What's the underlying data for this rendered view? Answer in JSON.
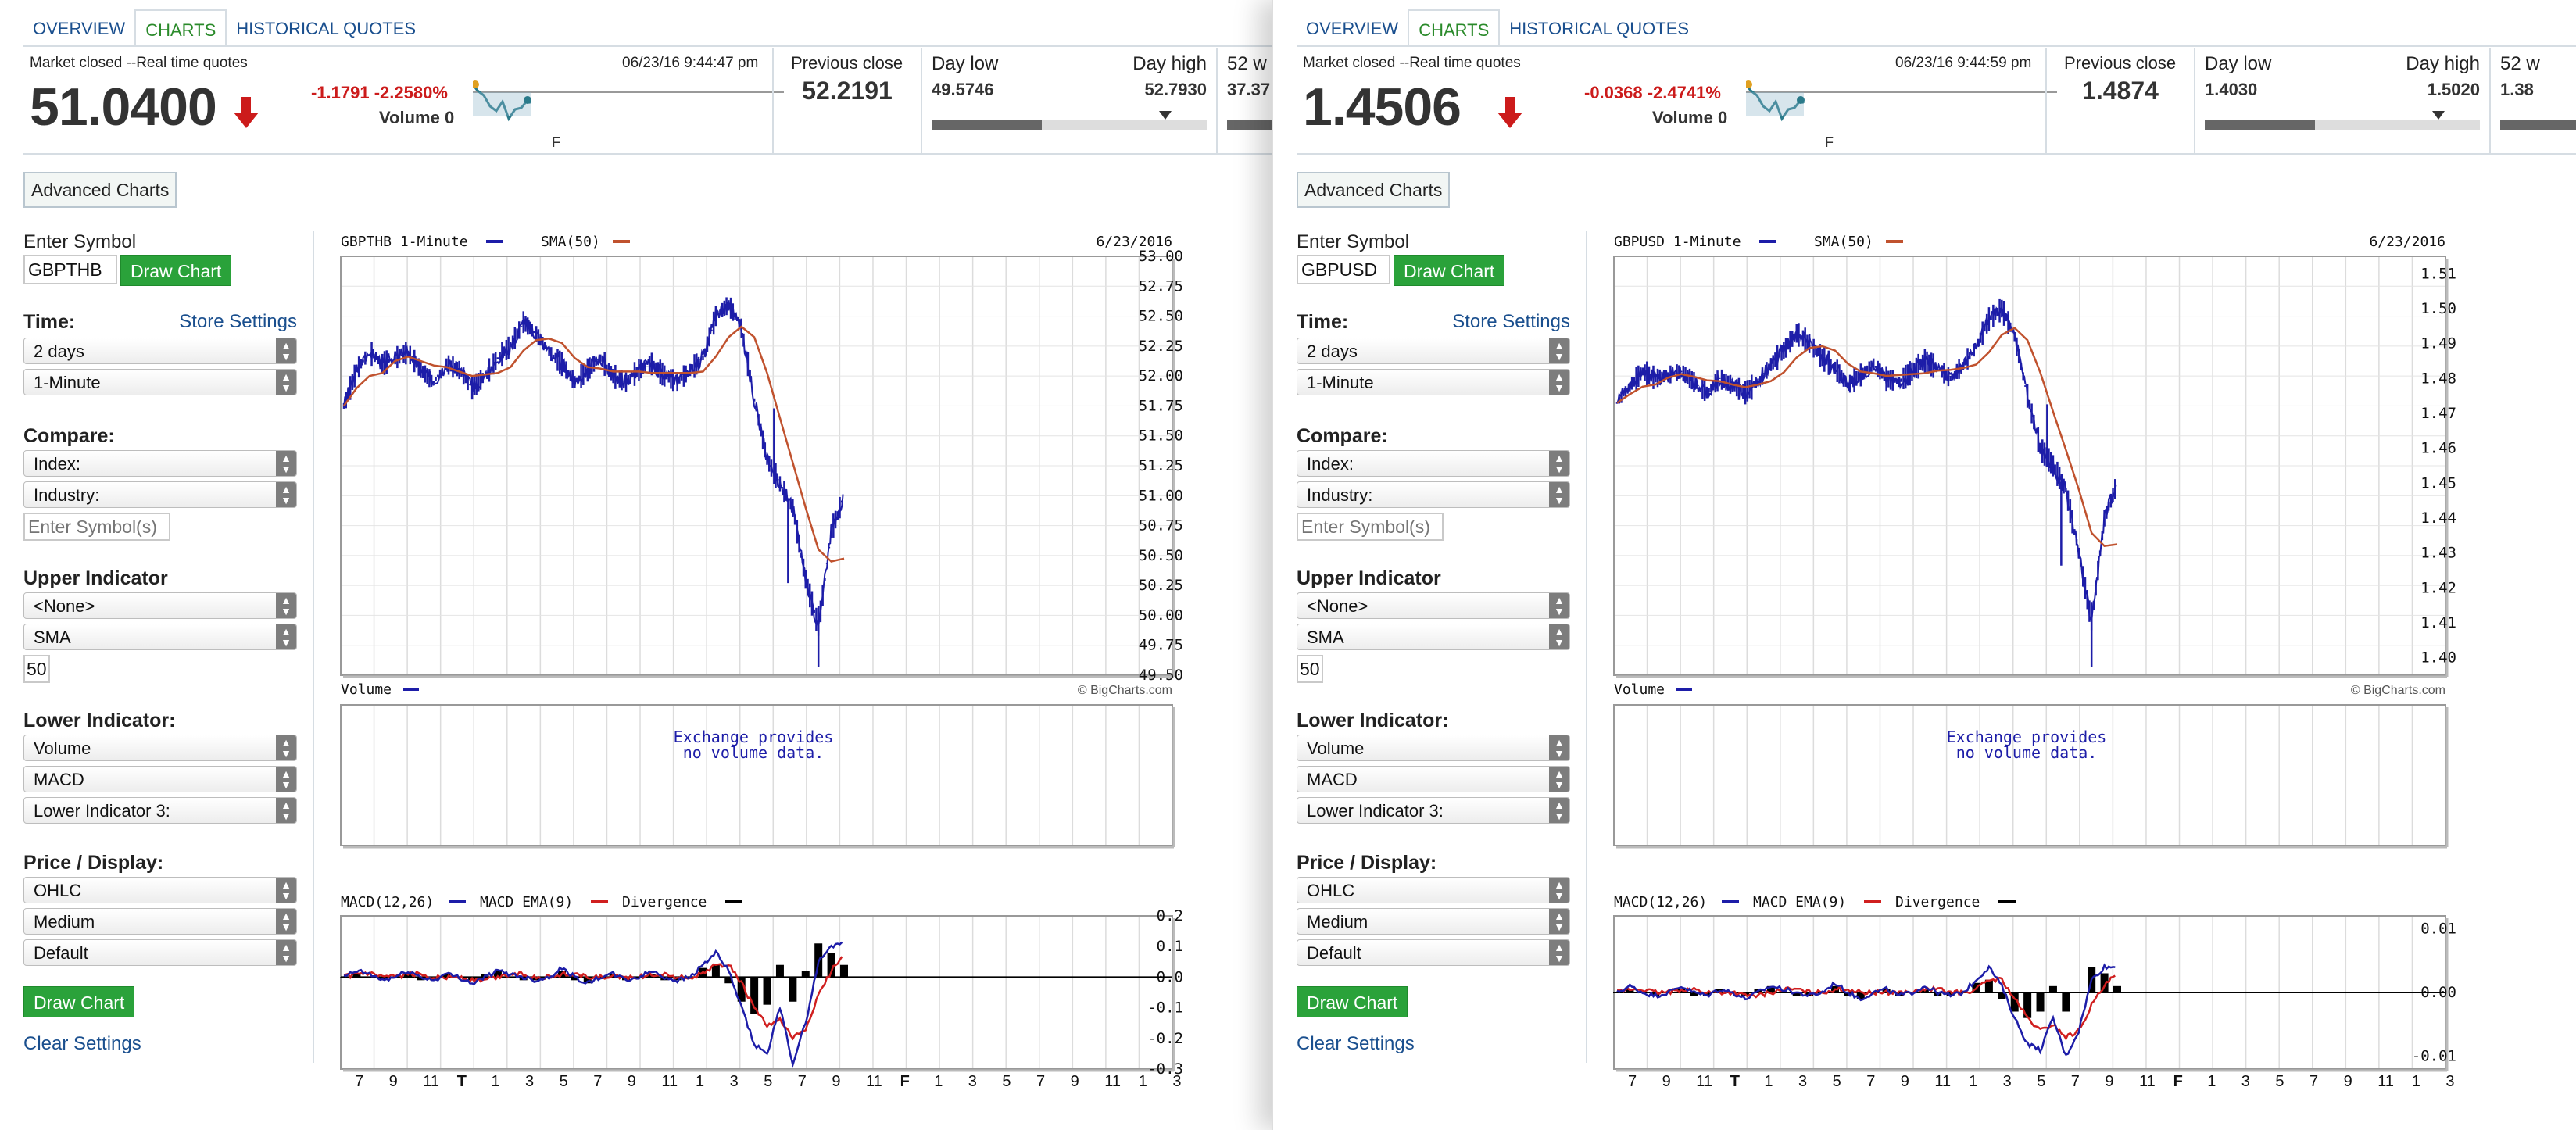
{
  "panes": [
    {
      "tabs": [
        "OVERVIEW",
        "CHARTS",
        "HISTORICAL QUOTES"
      ],
      "active_tab": 1,
      "quote": {
        "status": "Market closed --Real time quotes",
        "timestamp": "06/23/16 9:44:47 pm",
        "price": "51.0400",
        "change": "-1.1791 -2.2580%",
        "volume": "Volume 0",
        "sparkline_label": "F",
        "previous_close_label": "Previous close",
        "previous_close": "52.2191",
        "day_low_label": "Day low",
        "day_low": "49.5746",
        "day_high_label": "Day high",
        "day_high": "52.7930",
        "range_position": 0.4,
        "wk52_label": "52 w",
        "wk52_value": "37.37"
      },
      "sidebar": {
        "advanced_charts": "Advanced Charts",
        "enter_symbol_label": "Enter Symbol",
        "symbol_value": "GBPTHB",
        "draw_chart": "Draw Chart",
        "time_label": "Time:",
        "store_settings": "Store Settings",
        "time_range": "2 days",
        "time_interval": "1-Minute",
        "compare_label": "Compare:",
        "compare_index": "Index:",
        "compare_industry": "Industry:",
        "compare_symbols_placeholder": "Enter Symbol(s)",
        "upper_indicator_label": "Upper Indicator",
        "upper_indicator_1": "<None>",
        "upper_indicator_2": "SMA",
        "upper_param": "50",
        "lower_indicator_label": "Lower Indicator:",
        "lower_indicator_1": "Volume",
        "lower_indicator_2": "MACD",
        "lower_indicator_3": "Lower Indicator 3:",
        "price_display_label": "Price / Display:",
        "price_type": "OHLC",
        "size": "Medium",
        "scheme": "Default",
        "draw_chart_bottom": "Draw Chart",
        "clear_settings": "Clear Settings"
      },
      "chart_data": [
        {
          "type": "line",
          "title": "GBPTHB 1-Minute",
          "date": "6/23/2016",
          "series": [
            {
              "name": "GBPTHB 1-Minute",
              "color": "#1d1da8"
            },
            {
              "name": "SMA(50)",
              "color": "#c0522e"
            }
          ],
          "ylim": [
            49.5,
            53.0
          ],
          "yticks": [
            "53.00",
            "52.75",
            "52.50",
            "52.25",
            "52.00",
            "51.75",
            "51.50",
            "51.25",
            "51.00",
            "50.75",
            "50.50",
            "50.25",
            "50.00",
            "49.75",
            "49.50"
          ],
          "x": [
            "7",
            "9",
            "11",
            "T",
            "1",
            "3",
            "5",
            "7",
            "9",
            "11",
            "1",
            "3",
            "5",
            "7",
            "9",
            "11",
            "F",
            "1",
            "3",
            "5",
            "7",
            "9",
            "11",
            "1",
            "3"
          ],
          "values": [
            51.75,
            52.05,
            52.2,
            52.1,
            52.15,
            52.2,
            52.05,
            51.95,
            52.1,
            52.05,
            51.9,
            52.0,
            52.15,
            52.25,
            52.45,
            52.35,
            52.2,
            52.1,
            51.95,
            52.05,
            52.15,
            52.0,
            51.95,
            52.05,
            52.1,
            52.0,
            51.95,
            52.05,
            52.15,
            52.5,
            52.6,
            52.4,
            51.8,
            51.3,
            51.1,
            50.9,
            50.3,
            49.9,
            50.7,
            51.0
          ]
        },
        {
          "type": "bar",
          "title": "Volume",
          "note": "Exchange provides no volume data.",
          "credit": "© BigCharts.com"
        },
        {
          "type": "line",
          "series": [
            {
              "name": "MACD(12,26)",
              "color": "#1d1da8"
            },
            {
              "name": "MACD EMA(9)",
              "color": "#d01f1f"
            },
            {
              "name": "Divergence",
              "color": "#000000"
            }
          ],
          "ylim": [
            -0.3,
            0.2
          ],
          "yticks": [
            "0.2",
            "0.1",
            "0.0",
            "-0.1",
            "-0.2",
            "-0.3"
          ],
          "macd": [
            0.0,
            0.02,
            0.01,
            -0.01,
            0.0,
            0.02,
            0.0,
            -0.01,
            0.01,
            0.0,
            -0.02,
            0.0,
            0.02,
            0.01,
            0.0,
            -0.01,
            0.0,
            0.03,
            0.0,
            -0.02,
            0.0,
            0.01,
            -0.01,
            0.0,
            0.02,
            0.0,
            -0.01,
            0.0,
            0.04,
            0.08,
            0.02,
            -0.1,
            -0.22,
            -0.25,
            -0.1,
            -0.28,
            -0.15,
            0.05,
            0.1,
            0.12
          ],
          "ema": [
            0.0,
            0.01,
            0.01,
            0.0,
            0.0,
            0.01,
            0.01,
            0.0,
            0.0,
            0.0,
            -0.01,
            -0.01,
            0.0,
            0.01,
            0.01,
            0.0,
            0.0,
            0.01,
            0.01,
            0.0,
            0.0,
            0.0,
            0.0,
            0.0,
            0.01,
            0.01,
            0.0,
            0.0,
            0.01,
            0.04,
            0.04,
            -0.02,
            -0.1,
            -0.16,
            -0.14,
            -0.2,
            -0.17,
            -0.06,
            0.02,
            0.08
          ],
          "divergence_values": [
            0.0,
            0.01,
            0.0,
            -0.01,
            0.0,
            0.01,
            -0.01,
            -0.01,
            0.01,
            0.0,
            -0.01,
            0.01,
            0.02,
            0.0,
            -0.01,
            -0.01,
            0.0,
            0.02,
            -0.01,
            -0.02,
            0.0,
            0.01,
            -0.01,
            0.0,
            0.01,
            -0.01,
            -0.01,
            0.0,
            0.03,
            0.04,
            -0.02,
            -0.08,
            -0.12,
            -0.09,
            0.04,
            -0.08,
            0.02,
            0.11,
            0.08,
            0.04
          ]
        }
      ]
    },
    {
      "tabs": [
        "OVERVIEW",
        "CHARTS",
        "HISTORICAL QUOTES"
      ],
      "active_tab": 1,
      "quote": {
        "status": "Market closed --Real time quotes",
        "timestamp": "06/23/16 9:44:59 pm",
        "price": "1.4506",
        "change": "-0.0368 -2.4741%",
        "volume": "Volume 0",
        "sparkline_label": "F",
        "previous_close_label": "Previous close",
        "previous_close": "1.4874",
        "day_low_label": "Day low",
        "day_low": "1.4030",
        "day_high_label": "Day high",
        "day_high": "1.5020",
        "range_position": 0.4,
        "wk52_label": "52 w",
        "wk52_value": "1.38"
      },
      "sidebar": {
        "advanced_charts": "Advanced Charts",
        "enter_symbol_label": "Enter Symbol",
        "symbol_value": "GBPUSD",
        "draw_chart": "Draw Chart",
        "time_label": "Time:",
        "store_settings": "Store Settings",
        "time_range": "2 days",
        "time_interval": "1-Minute",
        "compare_label": "Compare:",
        "compare_index": "Index:",
        "compare_industry": "Industry:",
        "compare_symbols_placeholder": "Enter Symbol(s)",
        "upper_indicator_label": "Upper Indicator",
        "upper_indicator_1": "<None>",
        "upper_indicator_2": "SMA",
        "upper_param": "50",
        "lower_indicator_label": "Lower Indicator:",
        "lower_indicator_1": "Volume",
        "lower_indicator_2": "MACD",
        "lower_indicator_3": "Lower Indicator 3:",
        "price_display_label": "Price / Display:",
        "price_type": "OHLC",
        "size": "Medium",
        "scheme": "Default",
        "draw_chart_bottom": "Draw Chart",
        "clear_settings": "Clear Settings"
      },
      "chart_data": [
        {
          "type": "line",
          "title": "GBPUSD 1-Minute",
          "date": "6/23/2016",
          "series": [
            {
              "name": "GBPUSD 1-Minute",
              "color": "#1d1da8"
            },
            {
              "name": "SMA(50)",
              "color": "#c0522e"
            }
          ],
          "ylim": [
            1.395,
            1.515
          ],
          "yticks": [
            "1.51",
            "1.50",
            "1.49",
            "1.48",
            "1.47",
            "1.46",
            "1.45",
            "1.44",
            "1.43",
            "1.42",
            "1.41",
            "1.40"
          ],
          "x": [
            "7",
            "9",
            "11",
            "T",
            "1",
            "3",
            "5",
            "7",
            "9",
            "11",
            "1",
            "3",
            "5",
            "7",
            "9",
            "11",
            "F",
            "1",
            "3",
            "5",
            "7",
            "9",
            "11",
            "1",
            "3"
          ],
          "values": [
            1.473,
            1.478,
            1.482,
            1.48,
            1.481,
            1.482,
            1.479,
            1.476,
            1.48,
            1.478,
            1.476,
            1.479,
            1.484,
            1.488,
            1.493,
            1.49,
            1.486,
            1.483,
            1.478,
            1.481,
            1.484,
            1.48,
            1.479,
            1.482,
            1.485,
            1.483,
            1.48,
            1.484,
            1.489,
            1.497,
            1.5,
            1.492,
            1.475,
            1.46,
            1.455,
            1.448,
            1.43,
            1.41,
            1.44,
            1.45
          ]
        },
        {
          "type": "bar",
          "title": "Volume",
          "note": "Exchange provides no volume data.",
          "credit": "© BigCharts.com"
        },
        {
          "type": "line",
          "series": [
            {
              "name": "MACD(12,26)",
              "color": "#1d1da8"
            },
            {
              "name": "MACD EMA(9)",
              "color": "#d01f1f"
            },
            {
              "name": "Divergence",
              "color": "#000000"
            }
          ],
          "ylim": [
            -0.012,
            0.012
          ],
          "yticks": [
            "0.01",
            "0.00",
            "-0.01"
          ],
          "macd": [
            0.0,
            0.001,
            0.0,
            -0.0005,
            0.0,
            0.001,
            0.0,
            -0.0005,
            0.0005,
            0.0,
            -0.001,
            0.0,
            0.001,
            0.0005,
            0.0,
            -0.0005,
            0.0,
            0.0015,
            0.0,
            -0.001,
            0.0,
            0.0005,
            -0.0005,
            0.0,
            0.001,
            0.0,
            -0.0005,
            0.0,
            0.002,
            0.004,
            0.001,
            -0.004,
            -0.008,
            -0.009,
            -0.004,
            -0.01,
            -0.006,
            0.002,
            0.004,
            0.004
          ],
          "ema": [
            0.0,
            0.0005,
            0.0005,
            0.0,
            0.0,
            0.0005,
            0.0005,
            0.0,
            0.0,
            0.0,
            -0.0005,
            -0.0005,
            0.0,
            0.0005,
            0.0005,
            0.0,
            0.0,
            0.0005,
            0.0005,
            0.0,
            0.0,
            0.0,
            0.0,
            0.0,
            0.0005,
            0.0005,
            0.0,
            0.0,
            0.0005,
            0.002,
            0.002,
            -0.001,
            -0.004,
            -0.006,
            -0.005,
            -0.007,
            -0.006,
            -0.002,
            0.001,
            0.003
          ],
          "divergence_values": [
            0.0,
            0.0005,
            0.0,
            -0.0005,
            0.0,
            0.0005,
            -0.0005,
            -0.0005,
            0.0005,
            0.0,
            -0.0005,
            0.0005,
            0.001,
            0.0,
            -0.0005,
            -0.0005,
            0.0,
            0.001,
            -0.0005,
            -0.001,
            0.0,
            0.0005,
            -0.0005,
            0.0,
            0.0005,
            -0.0005,
            -0.0005,
            0.0,
            0.0015,
            0.002,
            -0.001,
            -0.003,
            -0.004,
            -0.003,
            0.001,
            -0.003,
            0.0,
            0.004,
            0.003,
            0.001
          ]
        }
      ]
    }
  ],
  "colors": {
    "link": "#1a4f8e",
    "active_tab": "#2a8a2a",
    "down": "#cc1b1b",
    "button_green": "#2aa23a",
    "grid": "#d9d9d9"
  },
  "icons": {
    "down_arrow": "down-arrow-icon",
    "select_chevron": "select-chevron-icon"
  }
}
